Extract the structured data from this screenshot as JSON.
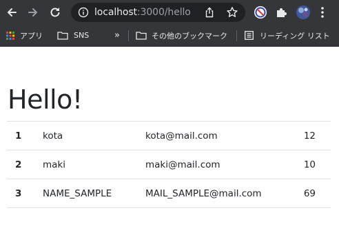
{
  "browser": {
    "url_host": "localhost",
    "url_path": ":3000/hello",
    "bookmarks": [
      {
        "label": "アプリ",
        "icon": "apps-grid-icon"
      },
      {
        "label": "SNS",
        "icon": "folder-icon"
      },
      {
        "label": "»",
        "icon": ""
      },
      {
        "label": "その他のブックマーク",
        "icon": "folder-icon"
      },
      {
        "label": "リーディング リスト",
        "icon": "reading-list-icon"
      }
    ],
    "colors": {
      "chrome_bg": "#35363a",
      "omnibox_bg": "#202124",
      "icon": "#e8eaed"
    }
  },
  "page": {
    "title": "Hello!",
    "rows": [
      {
        "idx": "1",
        "name": "kota",
        "mail": "kota@mail.com",
        "age": "12"
      },
      {
        "idx": "2",
        "name": "maki",
        "mail": "maki@mail.com",
        "age": "10"
      },
      {
        "idx": "3",
        "name": "NAME_SAMPLE",
        "mail": "MAIL_SAMPLE@mail.com",
        "age": "69"
      }
    ]
  }
}
